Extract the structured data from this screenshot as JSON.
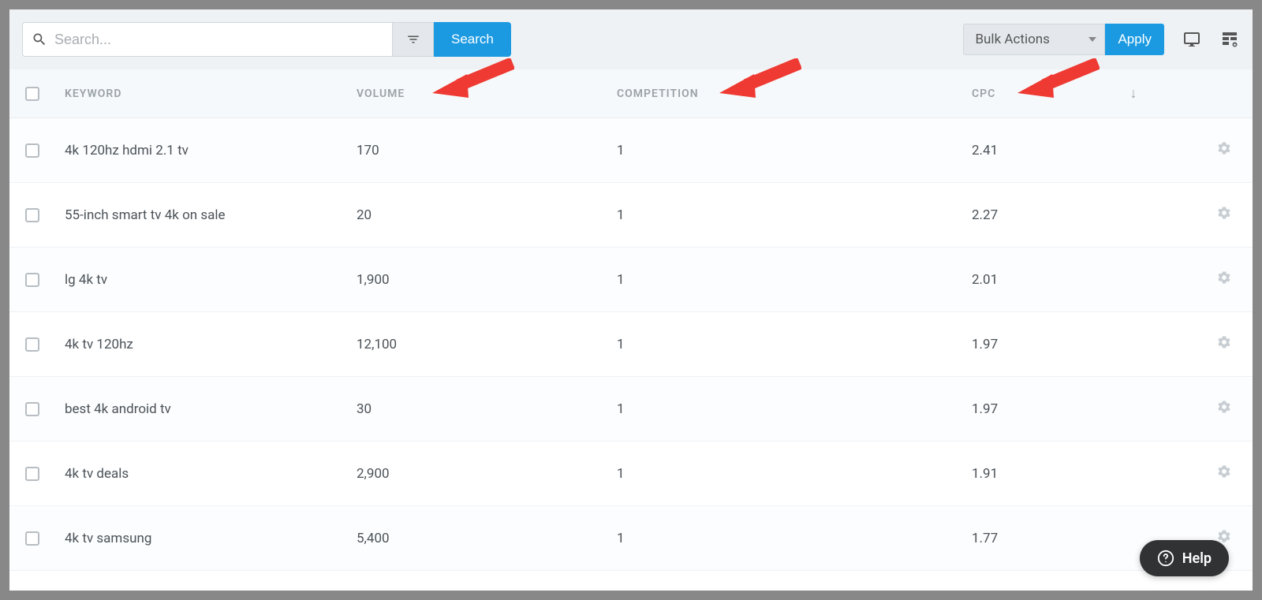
{
  "toolbar": {
    "search_placeholder": "Search...",
    "search_button_label": "Search",
    "bulk_actions_label": "Bulk Actions",
    "apply_button_label": "Apply"
  },
  "columns": {
    "keyword": "KEYWORD",
    "volume": "VOLUME",
    "competition": "COMPETITION",
    "cpc": "CPC",
    "sort_indicator": "↓"
  },
  "rows": [
    {
      "keyword": "4k 120hz hdmi 2.1 tv",
      "volume": "170",
      "competition": "1",
      "cpc": "2.41"
    },
    {
      "keyword": "55-inch smart tv 4k on sale",
      "volume": "20",
      "competition": "1",
      "cpc": "2.27"
    },
    {
      "keyword": "lg 4k tv",
      "volume": "1,900",
      "competition": "1",
      "cpc": "2.01"
    },
    {
      "keyword": "4k tv 120hz",
      "volume": "12,100",
      "competition": "1",
      "cpc": "1.97"
    },
    {
      "keyword": "best 4k android tv",
      "volume": "30",
      "competition": "1",
      "cpc": "1.97"
    },
    {
      "keyword": "4k tv deals",
      "volume": "2,900",
      "competition": "1",
      "cpc": "1.91"
    },
    {
      "keyword": "4k tv samsung",
      "volume": "5,400",
      "competition": "1",
      "cpc": "1.77"
    }
  ],
  "help_label": "Help",
  "annotations": {
    "arrows": [
      "volume",
      "competition",
      "cpc"
    ],
    "color": "#ee3a32"
  }
}
